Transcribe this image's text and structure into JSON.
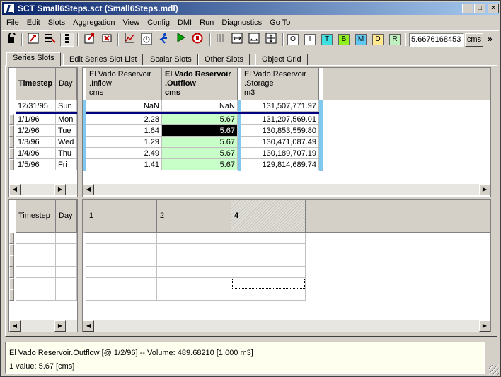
{
  "window": {
    "title": "SCT Small6Steps.sct (Small6Steps.mdl)",
    "buttons": {
      "minimize": "_",
      "maximize": "□",
      "close": "×"
    }
  },
  "menu": [
    "File",
    "Edit",
    "Slots",
    "Aggregation",
    "View",
    "Config",
    "DMI",
    "Run",
    "Diagnostics",
    "Go To"
  ],
  "toolbar": {
    "letter_buttons": [
      {
        "label": "O",
        "color": "#ffffff"
      },
      {
        "label": "I",
        "color": "#ffffff"
      },
      {
        "label": "T",
        "color": "#40e0e0"
      },
      {
        "label": "B",
        "color": "#90f020"
      },
      {
        "label": "M",
        "color": "#60c8f0"
      },
      {
        "label": "D",
        "color": "#ffe890"
      },
      {
        "label": "R",
        "color": "#c0f0c0"
      }
    ],
    "value": "5.6676168453",
    "units": "cms",
    "more": "»"
  },
  "tabs": [
    "Series Slots",
    "Edit Series Slot List",
    "Scalar Slots",
    "Other Slots",
    "Object Grid"
  ],
  "top_grid": {
    "row_headers": {
      "timestep": "Timestep",
      "day": "Day"
    },
    "columns": [
      {
        "line1": "El Vado Reservoir",
        "line2": ".Inflow",
        "line3": "cms",
        "bold": false
      },
      {
        "line1": "El Vado Reservoir",
        "line2": ".Outflow",
        "line3": "cms",
        "bold": true
      },
      {
        "line1": "El Vado Reservoir",
        "line2": ".Storage",
        "line3": "m3",
        "bold": false
      }
    ],
    "initial_row": {
      "date": "12/31/95",
      "day": "Sun",
      "values": [
        "NaN",
        "NaN",
        "131,507,771.97"
      ]
    },
    "rows": [
      {
        "date": "1/1/96",
        "day": "Mon",
        "values": [
          "2.28",
          "5.67",
          "131,207,569.01"
        ]
      },
      {
        "date": "1/2/96",
        "day": "Tue",
        "values": [
          "1.64",
          "5.67",
          "130,853,559.80"
        ]
      },
      {
        "date": "1/3/96",
        "day": "Wed",
        "values": [
          "1.29",
          "5.67",
          "130,471,087.49"
        ]
      },
      {
        "date": "1/4/96",
        "day": "Thu",
        "values": [
          "2.49",
          "5.67",
          "130,189,707.19"
        ]
      },
      {
        "date": "1/5/96",
        "day": "Fri",
        "values": [
          "1.41",
          "5.67",
          "129,814,689.74"
        ]
      }
    ]
  },
  "bottom_grid": {
    "row_headers": {
      "timestep": "Timestep",
      "day": "Day"
    },
    "columns": [
      "1",
      "2",
      "4"
    ]
  },
  "status": {
    "line1": "El Vado Reservoir.Outflow [@ 1/2/96] -- Volume: 489.68210 [1,000 m3]",
    "line2": "1 value:  5.67 [cms]"
  }
}
